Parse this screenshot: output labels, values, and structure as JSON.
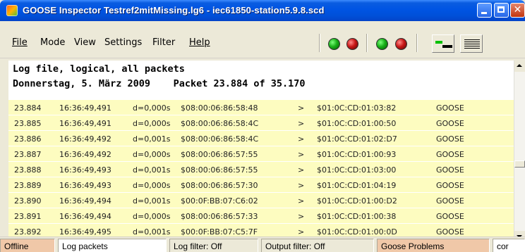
{
  "window": {
    "title": "GOOSE Inspector  Testref2mitMissing.lg6 - iec61850-station5.9.8.scd"
  },
  "menu": {
    "items": [
      {
        "label": "File"
      },
      {
        "label": "Mode"
      },
      {
        "label": "View"
      },
      {
        "label": "Settings"
      },
      {
        "label": "Filter"
      },
      {
        "label": "Help"
      }
    ]
  },
  "toolbar": {
    "indicators": [
      {
        "icon": "green-led-icon",
        "color": "#18b018"
      },
      {
        "icon": "red-led-icon",
        "color": "#c81818"
      },
      {
        "icon": "green-led-icon",
        "color": "#18b018"
      },
      {
        "icon": "red-led-icon",
        "color": "#c81818"
      }
    ],
    "buttons": [
      {
        "icon": "timeline-view-icon"
      },
      {
        "icon": "list-view-icon"
      }
    ]
  },
  "log": {
    "header_line1": "Log file, logical, all packets",
    "header_line2": "Donnerstag, 5. März 2009    Packet 23.884 of 35.170",
    "row_color": "#fdfcc0",
    "columns": [
      "no",
      "time",
      "delta",
      "source",
      "arrow",
      "destination",
      "type"
    ],
    "rows": [
      {
        "no": "23.884",
        "time": "16:36:49,491",
        "delta": "d=0,000s",
        "source": "$08:00:06:86:58:48",
        "arrow": ">",
        "destination": "$01:0C:CD:01:03:82",
        "type": "GOOSE"
      },
      {
        "no": "23.885",
        "time": "16:36:49,491",
        "delta": "d=0,000s",
        "source": "$08:00:06:86:58:4C",
        "arrow": ">",
        "destination": "$01:0C:CD:01:00:50",
        "type": "GOOSE"
      },
      {
        "no": "23.886",
        "time": "16:36:49,492",
        "delta": "d=0,001s",
        "source": "$08:00:06:86:58:4C",
        "arrow": ">",
        "destination": "$01:0C:CD:01:02:D7",
        "type": "GOOSE"
      },
      {
        "no": "23.887",
        "time": "16:36:49,492",
        "delta": "d=0,000s",
        "source": "$08:00:06:86:57:55",
        "arrow": ">",
        "destination": "$01:0C:CD:01:00:93",
        "type": "GOOSE"
      },
      {
        "no": "23.888",
        "time": "16:36:49,493",
        "delta": "d=0,001s",
        "source": "$08:00:06:86:57:55",
        "arrow": ">",
        "destination": "$01:0C:CD:01:03:00",
        "type": "GOOSE"
      },
      {
        "no": "23.889",
        "time": "16:36:49,493",
        "delta": "d=0,000s",
        "source": "$08:00:06:86:57:30",
        "arrow": ">",
        "destination": "$01:0C:CD:01:04:19",
        "type": "GOOSE"
      },
      {
        "no": "23.890",
        "time": "16:36:49,494",
        "delta": "d=0,001s",
        "source": "$00:0F:BB:07:C6:02",
        "arrow": ">",
        "destination": "$01:0C:CD:01:00:D2",
        "type": "GOOSE"
      },
      {
        "no": "23.891",
        "time": "16:36:49,494",
        "delta": "d=0,000s",
        "source": "$08:00:06:86:57:33",
        "arrow": ">",
        "destination": "$01:0C:CD:01:00:38",
        "type": "GOOSE"
      },
      {
        "no": "23.892",
        "time": "16:36:49,495",
        "delta": "d=0,001s",
        "source": "$00:0F:BB:07:C5:7F",
        "arrow": ">",
        "destination": "$01:0C:CD:01:00:0D",
        "type": "GOOSE"
      }
    ]
  },
  "status": {
    "connection": "Offline",
    "mode": "Log packets",
    "log_filter": "Log filter: Off",
    "output_filter": "Output filter: Off",
    "problems": "Goose Problems",
    "extra": "cor",
    "highlight_color": "#f0c8a8"
  }
}
